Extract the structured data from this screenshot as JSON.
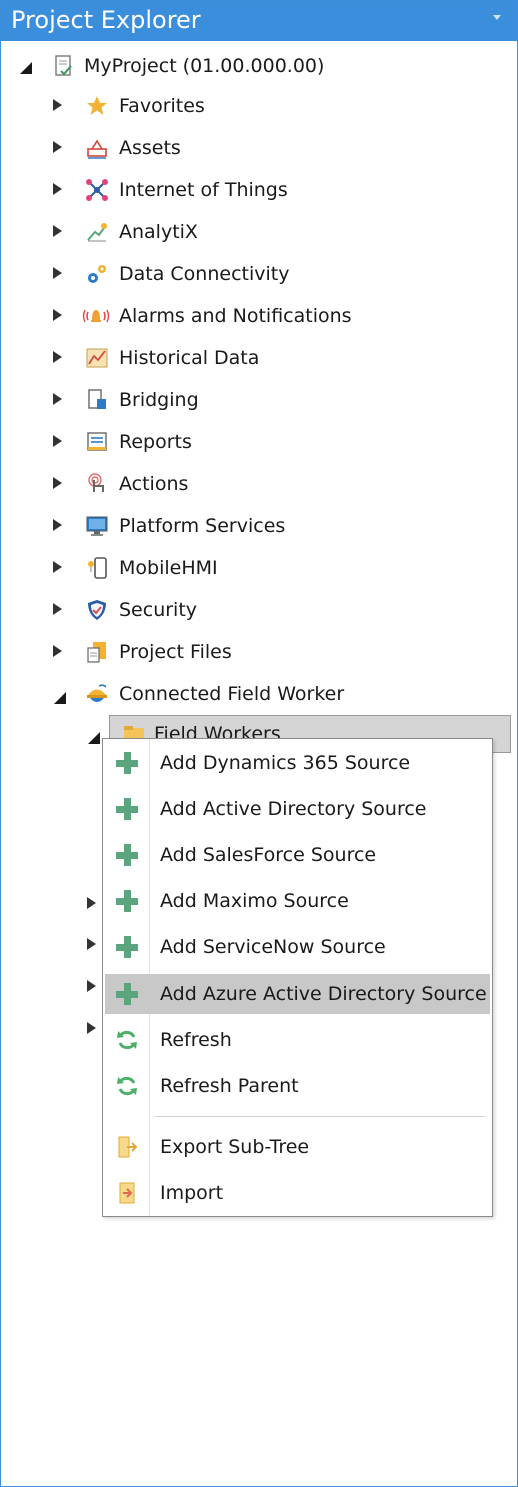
{
  "panel": {
    "title": "Project Explorer"
  },
  "tree": {
    "root": {
      "label": "MyProject (01.00.000.00)",
      "icon": "project-icon"
    },
    "items": [
      {
        "label": "Favorites",
        "icon": "star-icon"
      },
      {
        "label": "Assets",
        "icon": "assets-icon"
      },
      {
        "label": "Internet of Things",
        "icon": "iot-icon"
      },
      {
        "label": "AnalytiX",
        "icon": "analytix-icon"
      },
      {
        "label": "Data Connectivity",
        "icon": "gears-icon"
      },
      {
        "label": "Alarms and Notifications",
        "icon": "alarm-icon"
      },
      {
        "label": "Historical Data",
        "icon": "chart-icon"
      },
      {
        "label": "Bridging",
        "icon": "bridging-icon"
      },
      {
        "label": "Reports",
        "icon": "reports-icon"
      },
      {
        "label": "Actions",
        "icon": "actions-icon"
      },
      {
        "label": "Platform Services",
        "icon": "monitor-icon"
      },
      {
        "label": "MobileHMI",
        "icon": "mobile-icon"
      },
      {
        "label": "Security",
        "icon": "shield-icon"
      },
      {
        "label": "Project Files",
        "icon": "files-icon"
      },
      {
        "label": "Connected Field Worker",
        "icon": "field-worker-icon"
      }
    ],
    "selected": {
      "label": "Field Workers",
      "icon": "folder-icon"
    }
  },
  "context_menu": {
    "items": [
      {
        "label": "Add Dynamics 365 Source",
        "icon": "plus-icon"
      },
      {
        "label": "Add Active Directory Source",
        "icon": "plus-icon"
      },
      {
        "label": "Add SalesForce Source",
        "icon": "plus-icon"
      },
      {
        "label": "Add Maximo Source",
        "icon": "plus-icon"
      },
      {
        "label": "Add ServiceNow Source",
        "icon": "plus-icon"
      },
      {
        "label": "Add Azure Active Directory Source",
        "icon": "plus-icon"
      },
      {
        "label": "Refresh",
        "icon": "refresh-icon"
      },
      {
        "label": "Refresh Parent",
        "icon": "refresh-icon"
      },
      {
        "label": "Export Sub-Tree",
        "icon": "export-icon"
      },
      {
        "label": "Import",
        "icon": "import-icon"
      }
    ],
    "highlighted": "Add Azure Active Directory Source"
  },
  "colors": {
    "titlebar": "#3a8edc",
    "plus": "#5aa47e",
    "refresh": "#4caf6a",
    "highlight": "#c8c8c8"
  }
}
